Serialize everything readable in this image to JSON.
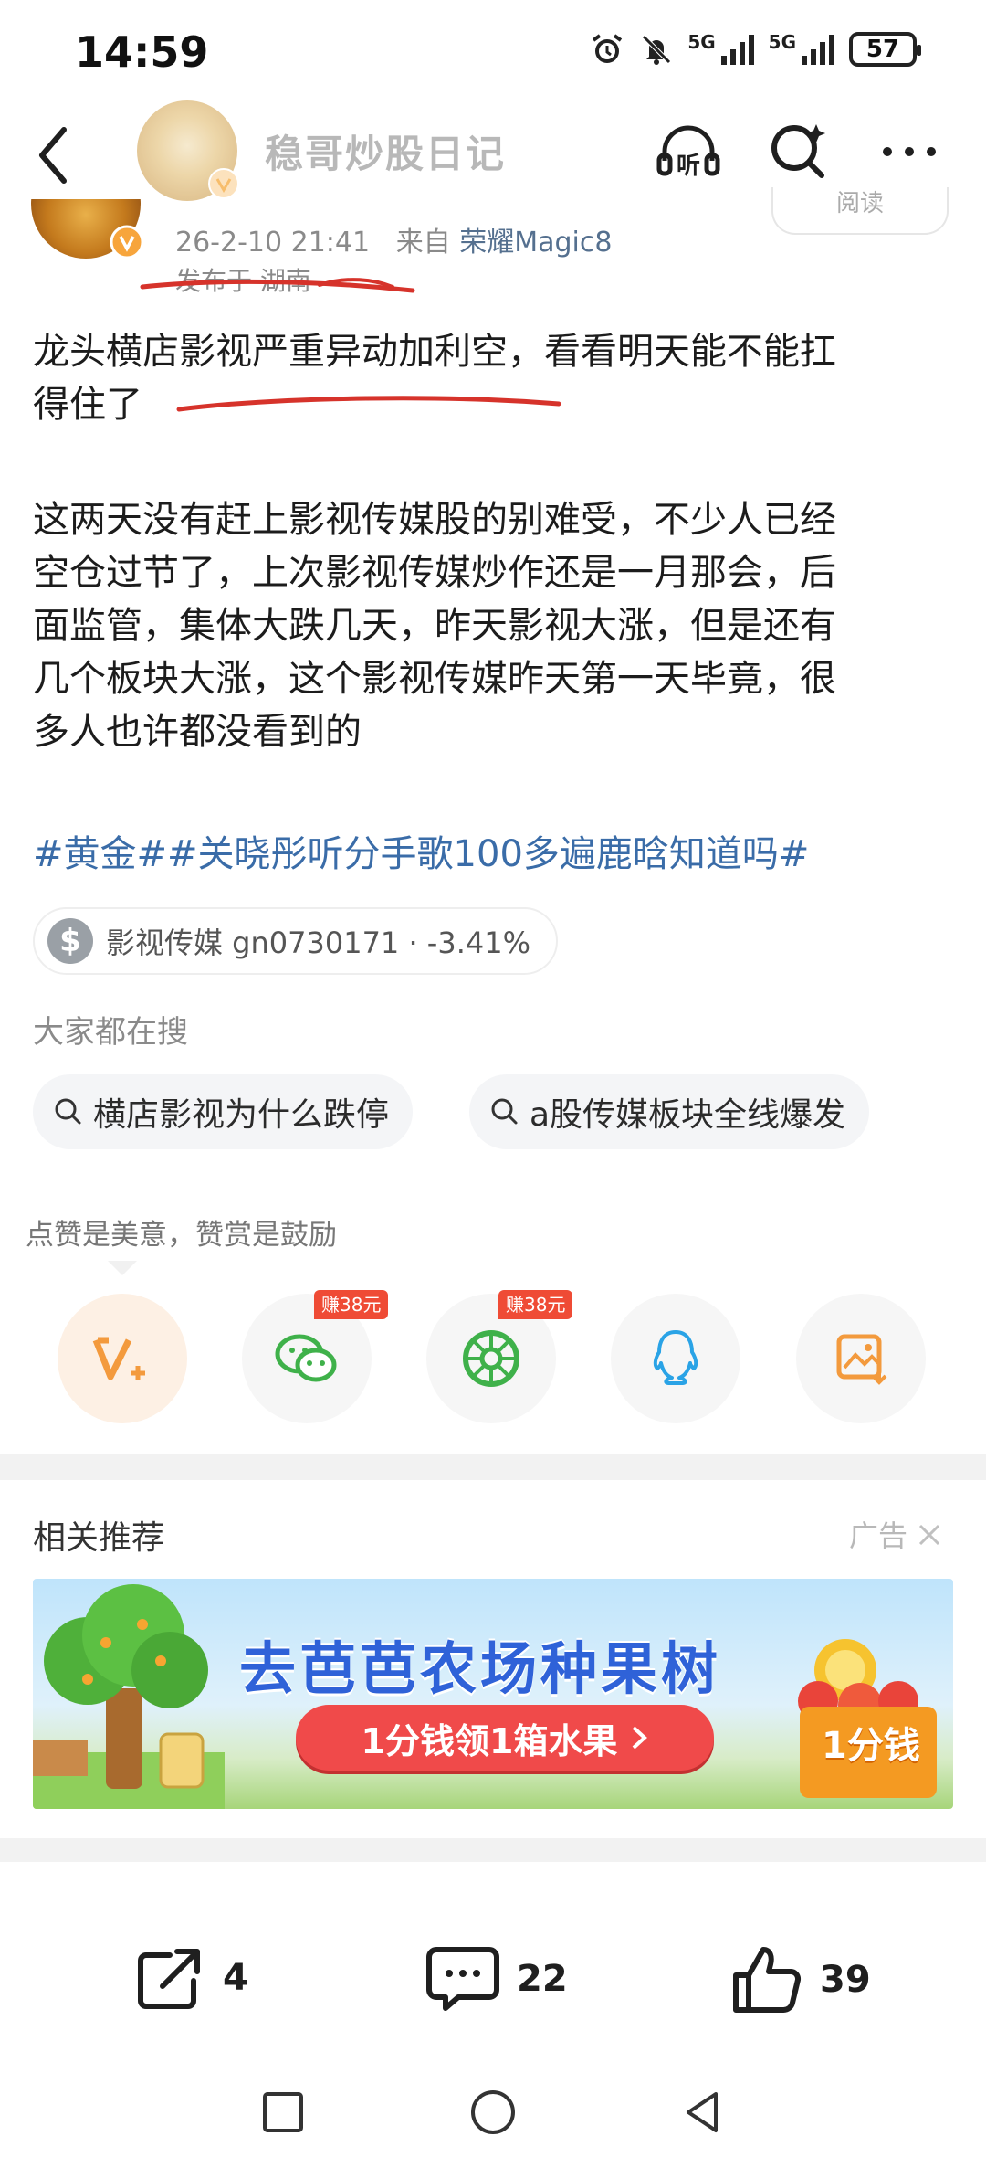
{
  "status_bar": {
    "time": "14:59",
    "battery": "57",
    "network_1": "5G",
    "network_2": "5G"
  },
  "header": {
    "title": "稳哥炒股日记"
  },
  "post": {
    "timestamp": "26-2-10 21:41",
    "source_prefix": "来自",
    "source": "荣耀Magic8",
    "location": "发布于 湖南",
    "read_label": "阅读",
    "paragraph1_line1": "龙头横店影视严重异动加利空，看看明天能不能扛",
    "paragraph1_line2": "得住了",
    "paragraph2_lines": [
      "这两天没有赶上影视传媒股的别难受，不少人已经",
      "空仓过节了，上次影视传媒炒作还是一月那会，后",
      "面监管，集体大跌几天，昨天影视大涨，但是还有",
      "几个板块大涨，这个影视传媒昨天第一天毕竟，很",
      "多人也许都没看到的"
    ],
    "hashtags": "#黄金##关晓彤听分手歌100多遍鹿晗知道吗#",
    "stock_chip": "影视传媒 gn0730171 · -3.41%"
  },
  "search": {
    "label": "大家都在搜",
    "chips": [
      "横店影视为什么跌停",
      "a股传媒板块全线爆发"
    ]
  },
  "reward": {
    "tip": "点赞是美意，赞赏是鼓励",
    "bonus_label": "赚38元"
  },
  "recommend": {
    "title": "相关推荐",
    "ad_label": "广告",
    "banner_title": "去芭芭农场种果树",
    "banner_button": "1分钱领1箱水果",
    "banner_price": "1分钱"
  },
  "actions": {
    "share_count": "4",
    "comment_count": "22",
    "like_count": "39"
  },
  "colors": {
    "link_blue": "#3a6ca8",
    "reward_orange": "#f39a3d",
    "wechat_green": "#3fb14a",
    "qq_blue": "#2aa3e6"
  }
}
